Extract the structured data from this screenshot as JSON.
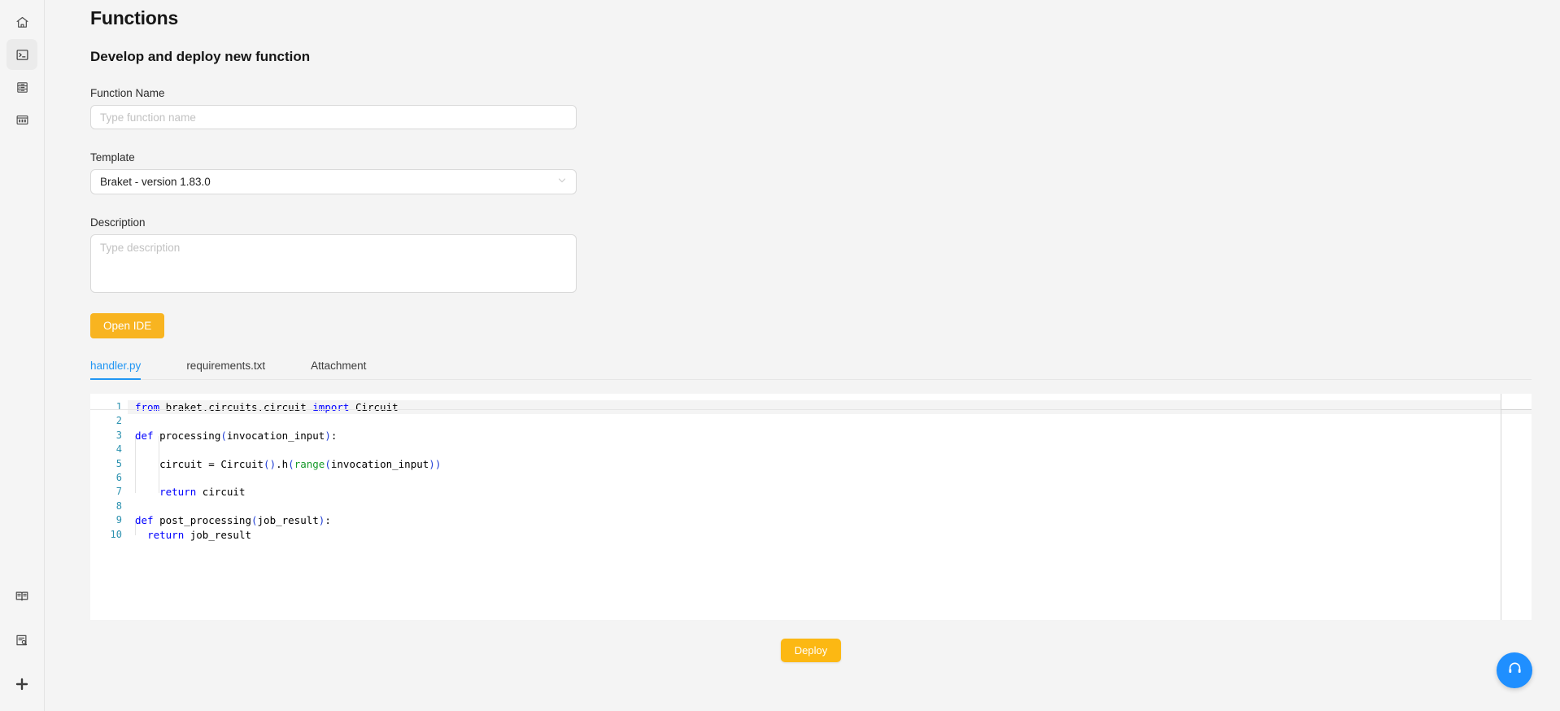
{
  "sidebar": {
    "top_items": [
      {
        "name": "home",
        "icon": "home-icon",
        "active": false
      },
      {
        "name": "terminal",
        "icon": "terminal-icon",
        "active": true
      },
      {
        "name": "storage",
        "icon": "server-stack-icon",
        "active": false
      },
      {
        "name": "dashboard",
        "icon": "dashboard-icon",
        "active": false
      }
    ],
    "bottom_items": [
      {
        "name": "docs",
        "icon": "book-icon",
        "active": false
      },
      {
        "name": "search-doc",
        "icon": "document-search-icon",
        "active": false
      },
      {
        "name": "integrations",
        "icon": "slack-icon",
        "active": false
      }
    ]
  },
  "page": {
    "title": "Functions",
    "section_title": "Develop and deploy new function"
  },
  "form": {
    "function_name": {
      "label": "Function Name",
      "value": "",
      "placeholder": "Type function name"
    },
    "template": {
      "label": "Template",
      "selected": "Braket - version 1.83.0",
      "options": [
        "Braket - version 1.83.0"
      ]
    },
    "description": {
      "label": "Description",
      "value": "",
      "placeholder": "Type description"
    },
    "open_ide_label": "Open IDE"
  },
  "tabs": [
    {
      "label": "handler.py",
      "active": true
    },
    {
      "label": "requirements.txt",
      "active": false
    },
    {
      "label": "Attachment",
      "active": false
    }
  ],
  "editor": {
    "line_numbers": [
      "1",
      "2",
      "3",
      "4",
      "5",
      "6",
      "7",
      "8",
      "9",
      "10"
    ],
    "lines": [
      "from braket.circuits.circuit import Circuit",
      "",
      "def processing(invocation_input):",
      "",
      "    circuit = Circuit().h(range(invocation_input))",
      "",
      "    return circuit",
      "",
      "def post_processing(job_result):",
      "  return job_result"
    ]
  },
  "actions": {
    "deploy_label": "Deploy"
  },
  "support": {
    "icon": "headset-icon"
  },
  "colors": {
    "accent_yellow": "#fcb813",
    "accent_blue": "#2196f3",
    "support_blue": "#1f8fff",
    "page_bg": "#f4f4f4",
    "panel_bg": "#ffffff"
  }
}
